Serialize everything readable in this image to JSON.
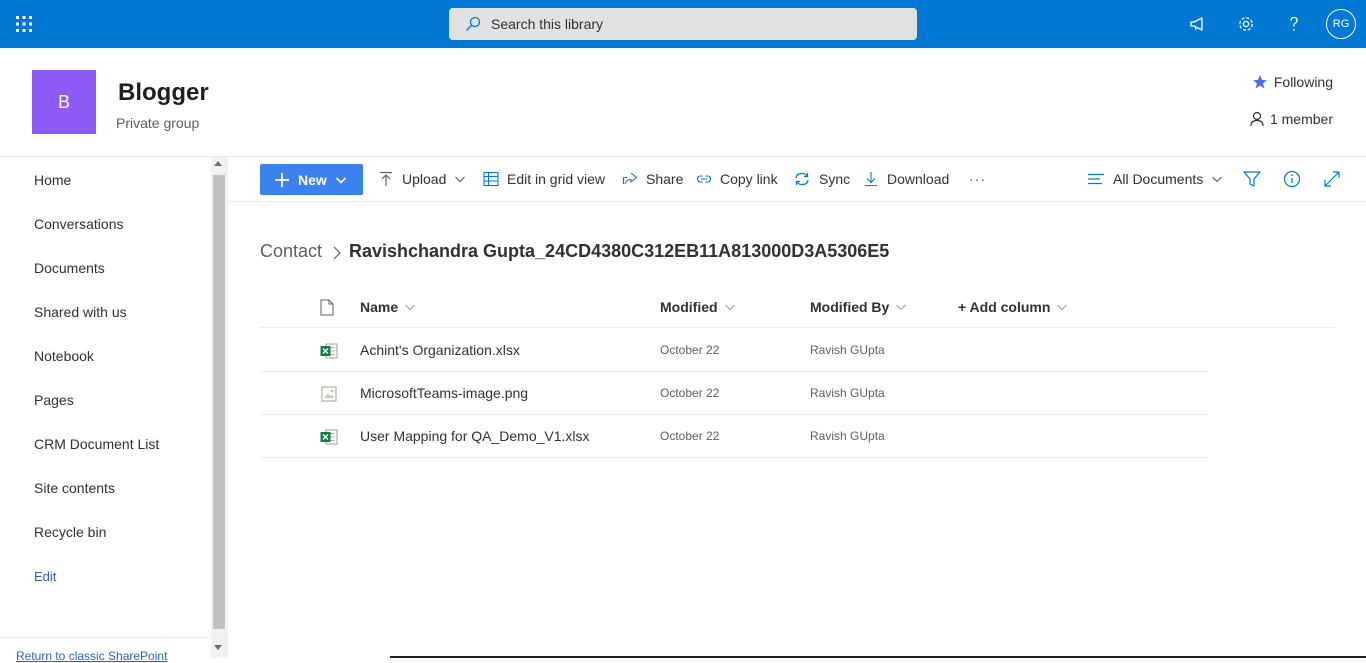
{
  "suite": {
    "search_placeholder": "Search this library",
    "avatar_initials": "RG",
    "accent_color": "#0078d4"
  },
  "site": {
    "logo_letter": "B",
    "logo_color": "#8c5af7",
    "title": "Blogger",
    "subtitle": "Private group",
    "following_label": "Following",
    "members_label": "1 member"
  },
  "nav": {
    "items": [
      {
        "label": "Home"
      },
      {
        "label": "Conversations"
      },
      {
        "label": "Documents"
      },
      {
        "label": "Shared with us"
      },
      {
        "label": "Notebook"
      },
      {
        "label": "Pages"
      },
      {
        "label": "CRM Document List"
      },
      {
        "label": "Site contents"
      },
      {
        "label": "Recycle bin"
      }
    ],
    "edit_label": "Edit",
    "classic_label": "Return to classic SharePoint"
  },
  "commandbar": {
    "new_label": "New",
    "upload_label": "Upload",
    "grid_label": "Edit in grid view",
    "share_label": "Share",
    "copylink_label": "Copy link",
    "sync_label": "Sync",
    "download_label": "Download",
    "more_label": "···",
    "view_label": "All Documents"
  },
  "breadcrumb": {
    "root": "Contact",
    "current": "Ravishchandra Gupta_24CD4380C312EB11A813000D3A5306E5"
  },
  "list": {
    "columns": {
      "name": "Name",
      "modified": "Modified",
      "modified_by": "Modified By",
      "add_column": "+ Add column"
    },
    "rows": [
      {
        "name": "Achint's Organization.xlsx",
        "type": "excel-icon",
        "modified": "October 22",
        "modified_by": "Ravish GUpta"
      },
      {
        "name": "MicrosoftTeams-image.png",
        "type": "image-icon",
        "modified": "October 22",
        "modified_by": "Ravish GUpta"
      },
      {
        "name": "User Mapping for QA_Demo_V1.xlsx",
        "type": "excel-icon",
        "modified": "October 22",
        "modified_by": "Ravish GUpta"
      }
    ]
  }
}
